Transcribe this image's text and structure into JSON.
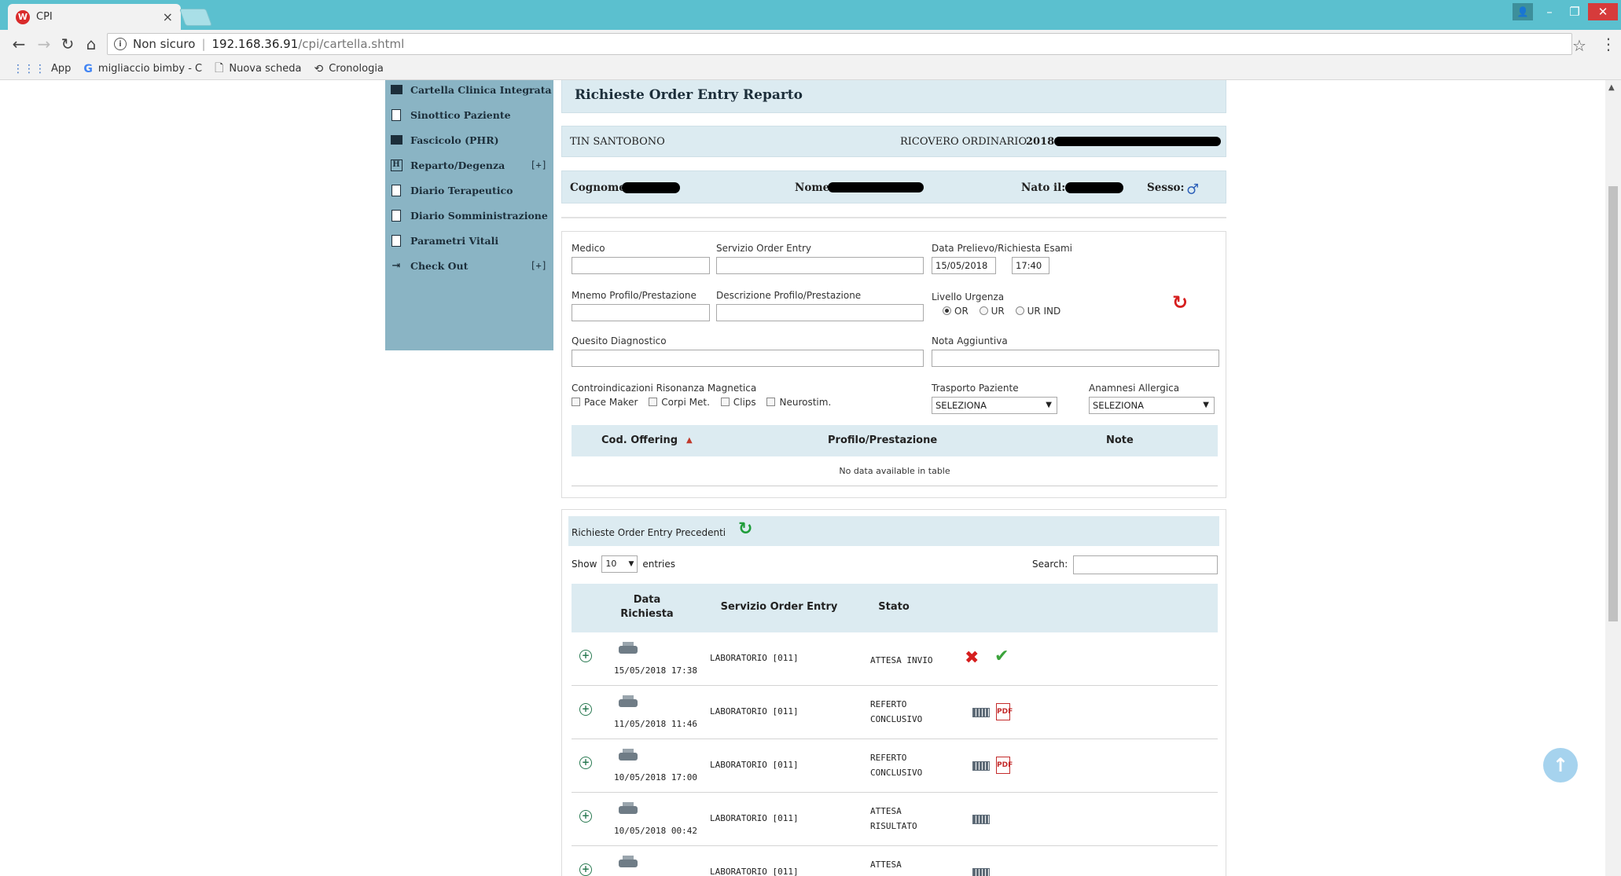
{
  "browser": {
    "tab_title": "CPI",
    "tab_close": "×",
    "url_security": "Non sicuro",
    "url_host": "192.168.36.91",
    "url_path": "/cpi/cartella.shtml",
    "bookmarks": [
      {
        "label": "App",
        "icon": "apps-grid-icon"
      },
      {
        "label": "migliaccio bimby - C",
        "icon": "google-g-icon"
      },
      {
        "label": "Nuova scheda",
        "icon": "page-icon"
      },
      {
        "label": "Cronologia",
        "icon": "history-icon"
      }
    ]
  },
  "sidebar": {
    "items": [
      {
        "label": "Cartella Clinica Integrata",
        "icon": "book-icon",
        "suffix": ""
      },
      {
        "label": "Sinottico Paziente",
        "icon": "document-icon",
        "suffix": ""
      },
      {
        "label": "Fascicolo (PHR)",
        "icon": "book-icon",
        "suffix": ""
      },
      {
        "label": "Reparto/Degenza",
        "icon": "h-box-icon",
        "suffix": "[+]"
      },
      {
        "label": "Diario Terapeutico",
        "icon": "document-icon",
        "suffix": ""
      },
      {
        "label": "Diario Somministrazione",
        "icon": "document-icon",
        "suffix": ""
      },
      {
        "label": "Parametri Vitali",
        "icon": "document-icon",
        "suffix": ""
      },
      {
        "label": "Check Out",
        "icon": "exit-icon",
        "suffix": "[+]"
      }
    ]
  },
  "header": {
    "title": "Richieste Order Entry Reparto",
    "ward": "TIN SANTOBONO",
    "admission_type": "RICOVERO ORDINARIO",
    "admission_code_prefix": "2018"
  },
  "patient": {
    "surname_label": "Cognome:",
    "name_label": "Nome:",
    "born_label": "Nato il:",
    "sex_label": "Sesso:",
    "sex_symbol": "♂"
  },
  "form": {
    "medico_label": "Medico",
    "servizio_label": "Servizio Order Entry",
    "data_label": "Data Prelievo/Richiesta Esami",
    "date_value": "15/05/2018",
    "time_value": "17:40",
    "mnemo_label": "Mnemo Profilo/Prestazione",
    "descr_label": "Descrizione Profilo/Prestazione",
    "urgenza_label": "Livello Urgenza",
    "urgenza_options": [
      "OR",
      "UR",
      "UR IND"
    ],
    "quesito_label": "Quesito Diagnostico",
    "nota_label": "Nota Aggiuntiva",
    "controind_label": "Controindicazioni Risonanza Magnetica",
    "controind_options": [
      "Pace Maker",
      "Corpi Met.",
      "Clips",
      "Neurostim."
    ],
    "trasporto_label": "Trasporto Paziente",
    "trasporto_value": "SELEZIONA",
    "anamnesi_label": "Anamnesi Allergica",
    "anamnesi_value": "SELEZIONA",
    "table_headers": [
      "Cod. Offering",
      "Profilo/Prestazione",
      "Note"
    ],
    "table_empty": "No data available in table"
  },
  "previous": {
    "title": "Richieste Order Entry Precedenti",
    "show_label": "Show",
    "show_value": "10",
    "entries_label": "entries",
    "search_label": "Search:",
    "headers": [
      "Data Richiesta",
      "Servizio Order Entry",
      "Stato"
    ],
    "rows": [
      {
        "date": "15/05/2018 17:38",
        "service": "LABORATORIO [011]",
        "status": "ATTESA INVIO",
        "actions": [
          "delete-x-icon",
          "confirm-check-icon"
        ]
      },
      {
        "date": "11/05/2018 11:46",
        "service": "LABORATORIO [011]",
        "status": "REFERTO CONCLUSIVO",
        "actions": [
          "grid-icon",
          "pdf-icon"
        ]
      },
      {
        "date": "10/05/2018 17:00",
        "service": "LABORATORIO [011]",
        "status": "REFERTO CONCLUSIVO",
        "actions": [
          "grid-icon",
          "pdf-icon"
        ]
      },
      {
        "date": "10/05/2018 00:42",
        "service": "LABORATORIO [011]",
        "status": "ATTESA RISULTATO",
        "actions": [
          "grid-icon"
        ]
      },
      {
        "date": "",
        "service": "LABORATORIO [011]",
        "status": "ATTESA",
        "actions": [
          "grid-icon"
        ]
      }
    ]
  },
  "colors": {
    "titlebar": "#5bc0cf",
    "sidebar": "#8ab4c4",
    "panel_header": "#dcebf1",
    "delete_red": "#d61e1e",
    "confirm_green": "#3ba33b"
  }
}
